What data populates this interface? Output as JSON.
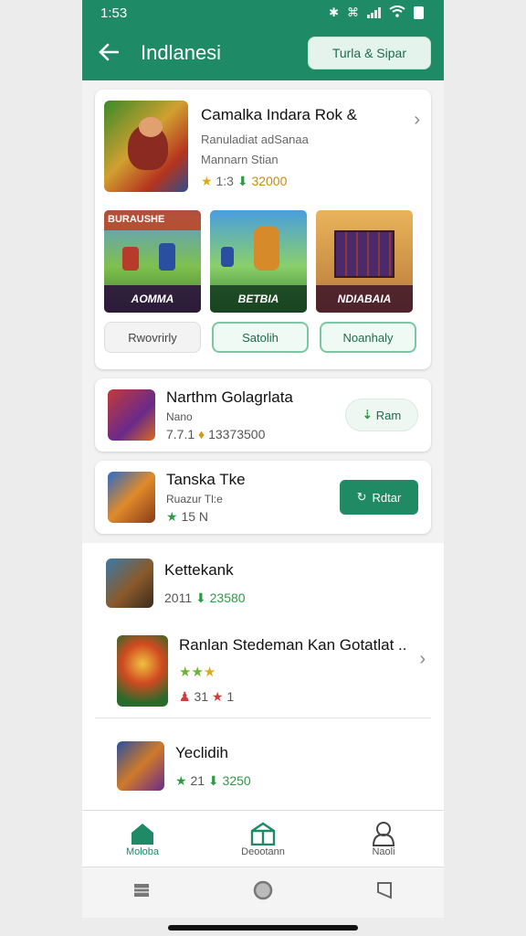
{
  "status": {
    "time": "1:53"
  },
  "appbar": {
    "title": "Indlanesi",
    "action_label": "Turla & Sipar"
  },
  "featured": {
    "title": "Camalka Indara Rok &",
    "sub1": "Ranuladiat adSanaa",
    "sub2": "Mannarn Stian",
    "rating": "1:3",
    "downloads": "32000",
    "shots": [
      {
        "top": "BURAUSHE",
        "label": "AOMMA"
      },
      {
        "top": "",
        "label": "BETBIA"
      },
      {
        "top": "",
        "label": "NDIABAIA"
      }
    ],
    "chips": [
      "Rwovrirly",
      "Satolih",
      "Noanhaly"
    ]
  },
  "row1": {
    "title": "Narthm Golagrlata",
    "sub": "Nano",
    "meta_a": "7.7.1",
    "meta_b": "13373500",
    "button": "Ram"
  },
  "row2": {
    "title": "Tanska Tke",
    "sub": "Ruazur Tl:e",
    "rating": "15 N",
    "button": "Rdtar"
  },
  "list": [
    {
      "title": "Kettekank",
      "meta_a": "2011",
      "meta_b": "23580"
    },
    {
      "title": "Ranlan Stedeman Kan Gotatlat ..",
      "stars": "★★",
      "star_o": "★",
      "meta_a": "31",
      "meta_b": "1"
    },
    {
      "title": "Yeclidih",
      "meta_a": "21",
      "meta_b": "3250"
    }
  ],
  "nav": [
    {
      "label": "Moloba"
    },
    {
      "label": "Deootann"
    },
    {
      "label": "Naoli"
    }
  ],
  "colors": {
    "brand": "#1e8a66",
    "accent_light": "#e4f4ec"
  }
}
